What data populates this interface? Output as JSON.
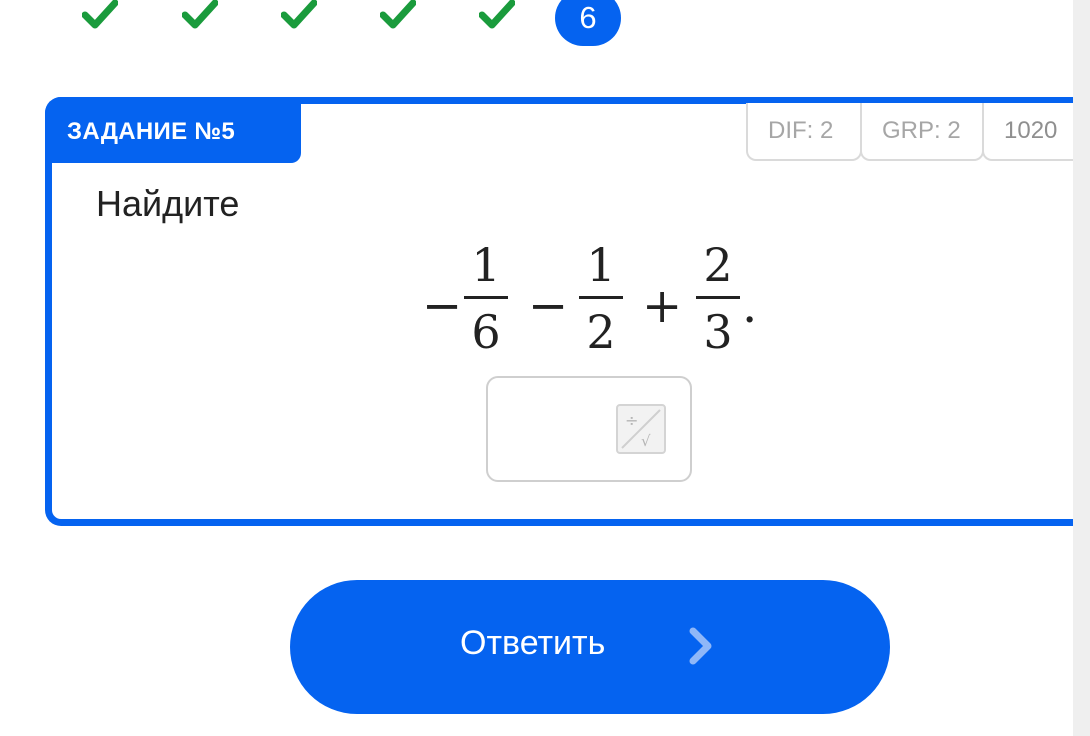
{
  "progress": {
    "completed_steps": [
      1,
      2,
      3,
      4,
      5
    ],
    "current_step": "6",
    "check_color": "#1a9b3c"
  },
  "task": {
    "title": "ЗАДАНИЕ №5",
    "dif": "DIF: 2",
    "grp": "GRP: 2",
    "id": "1020",
    "prompt": "Найдите",
    "expression": {
      "lead_sign": "−",
      "f1_num": "1",
      "f1_den": "6",
      "op1": "−",
      "f2_num": "1",
      "f2_den": "2",
      "op2": "+",
      "f3_num": "2",
      "f3_den": "3",
      "end": "."
    }
  },
  "answer": {
    "value": "",
    "keyboard_icon": "math-keyboard-icon"
  },
  "submit": {
    "label": "Ответить"
  },
  "colors": {
    "accent": "#0563f0",
    "text": "#222222",
    "muted": "#a6a6a6"
  }
}
